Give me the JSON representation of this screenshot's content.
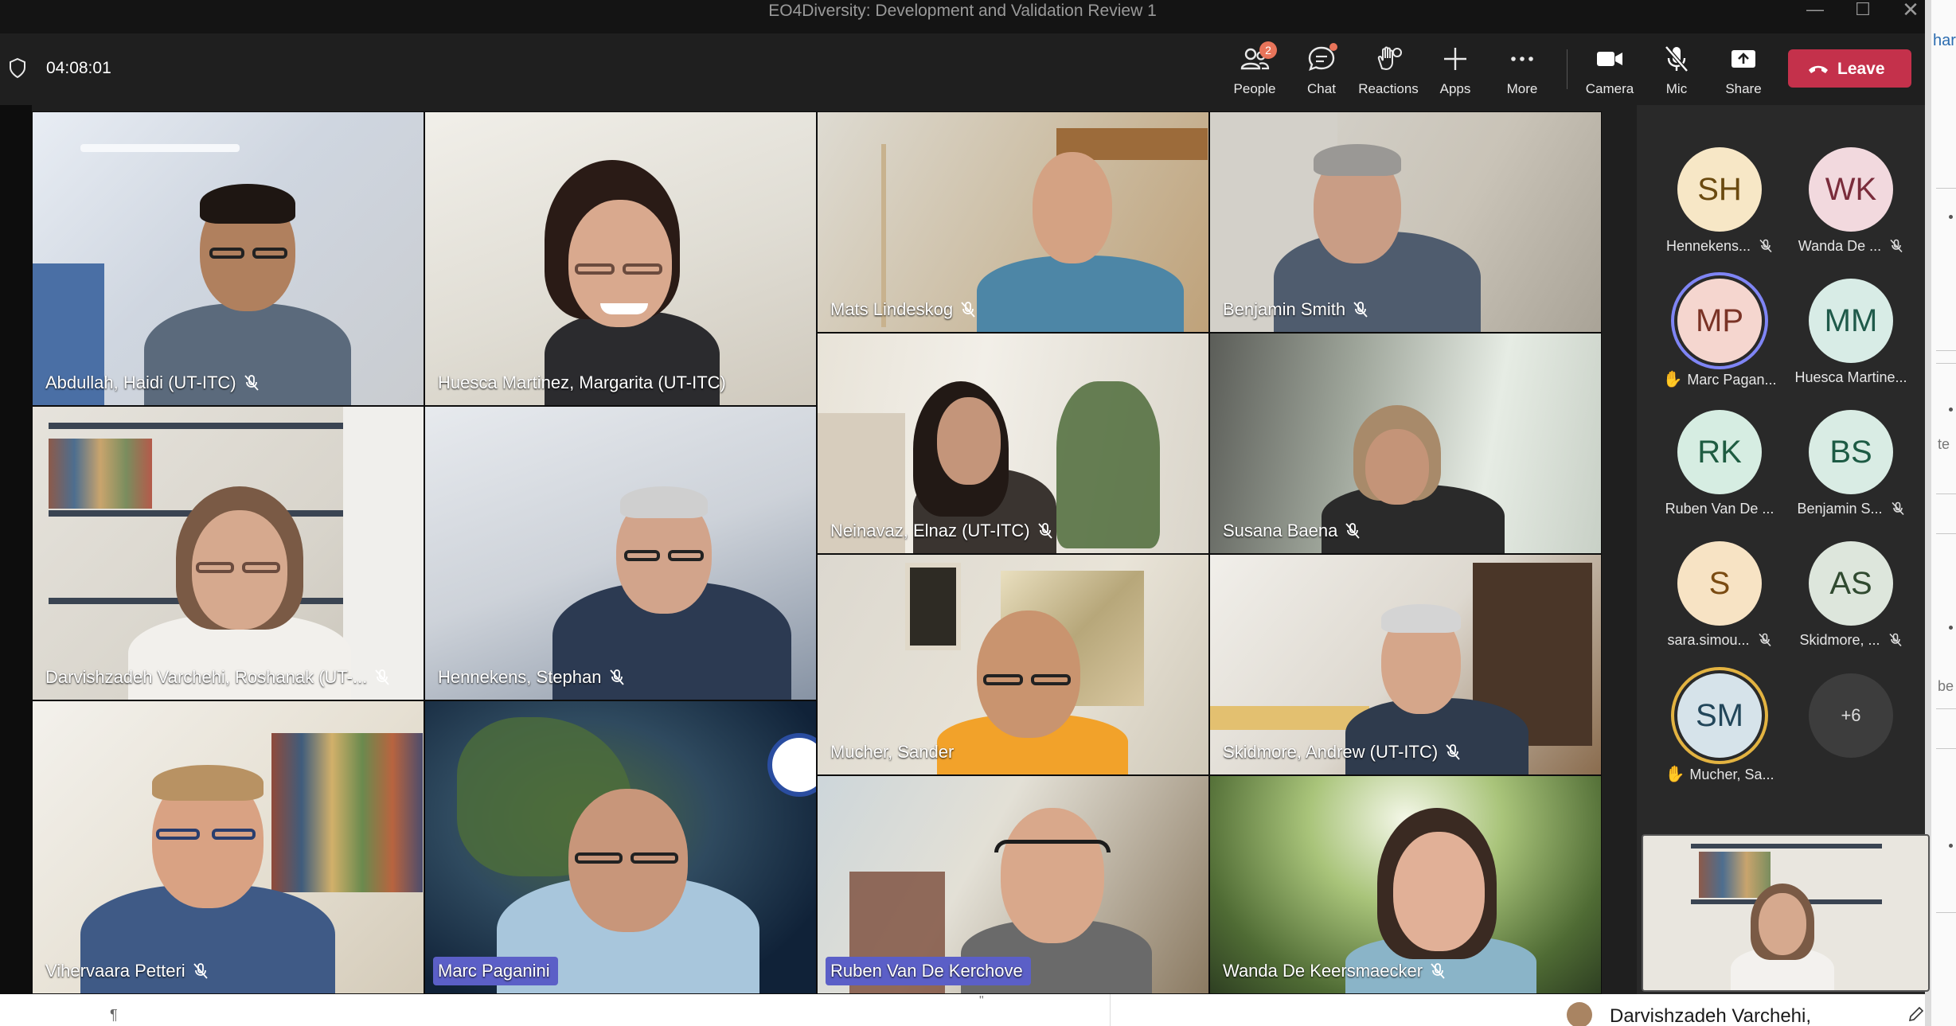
{
  "window": {
    "title": "EO4Diversity: Development and Validation Review 1",
    "side_peek_text": "har",
    "side_peek_fragments": [
      "te",
      "be"
    ]
  },
  "toolbar": {
    "timer": "04:08:01",
    "buttons": [
      {
        "label": "People",
        "icon": "people-icon",
        "badge": "2"
      },
      {
        "label": "Chat",
        "icon": "chat-icon"
      },
      {
        "label": "Reactions",
        "icon": "reactions-icon"
      },
      {
        "label": "Apps",
        "icon": "plus-icon"
      },
      {
        "label": "More",
        "icon": "ellipsis-icon"
      },
      {
        "label": "Camera",
        "icon": "camera-icon"
      },
      {
        "label": "Mic",
        "icon": "mic-off-icon"
      },
      {
        "label": "Share",
        "icon": "share-icon"
      }
    ],
    "leave_label": "Leave",
    "colors": {
      "leave": "#c4314b",
      "badge": "#e8745a",
      "accent": "#5b5fc7"
    }
  },
  "video_tiles": [
    {
      "name": "Abdullah, Haidi (UT-ITC)",
      "muted": true
    },
    {
      "name": "Huesca Martinez, Margarita (UT-ITC)",
      "muted": false
    },
    {
      "name": "Mats Lindeskog",
      "muted": true
    },
    {
      "name": "Benjamin Smith",
      "muted": true
    },
    {
      "name": "Neinavaz, Elnaz (UT-ITC)",
      "muted": true
    },
    {
      "name": "Susana Baena",
      "muted": true
    },
    {
      "name": "Darvishzadeh Varchehi, Roshanak (UT-...",
      "muted": true
    },
    {
      "name": "Hennekens, Stephan",
      "muted": true
    },
    {
      "name": "Mucher, Sander",
      "muted": false
    },
    {
      "name": "Skidmore, Andrew (UT-ITC)",
      "muted": true
    },
    {
      "name": "Vihervaara Petteri",
      "muted": true
    },
    {
      "name": "Marc Paganini",
      "muted": false,
      "speaking": true
    },
    {
      "name": "Ruben Van De Kerchove",
      "muted": false,
      "speaking": true
    },
    {
      "name": "Wanda De Keersmaecker",
      "muted": true
    }
  ],
  "participants": [
    {
      "initials": "SH",
      "name": "Hennekens...",
      "muted": true,
      "color": "#f7e7c6",
      "text": "#6b4a10"
    },
    {
      "initials": "WK",
      "name": "Wanda De ...",
      "muted": true,
      "color": "#f2d9de",
      "text": "#7a2c3b"
    },
    {
      "initials": "MP",
      "name": "Marc Pagan...",
      "muted": false,
      "hand": true,
      "color": "#f5d6cf",
      "text": "#7a3326",
      "ring": "#7f85f5"
    },
    {
      "initials": "MM",
      "name": "Huesca Martine...",
      "muted": false,
      "color": "#d8ece6",
      "text": "#1f5a4a"
    },
    {
      "initials": "RK",
      "name": "Ruben Van De ...",
      "muted": false,
      "color": "#d6ede2",
      "text": "#1e5c41"
    },
    {
      "initials": "BS",
      "name": "Benjamin S...",
      "muted": true,
      "color": "#d9ece4",
      "text": "#1d5b44"
    },
    {
      "initials": "S",
      "name": "sara.simou...",
      "muted": true,
      "color": "#f7e3c4",
      "text": "#7a4b12"
    },
    {
      "initials": "AS",
      "name": "Skidmore, ...",
      "muted": true,
      "color": "#dde6dc",
      "text": "#304a30"
    },
    {
      "initials": "SM",
      "name": "Mucher, Sa...",
      "muted": false,
      "hand": true,
      "color": "#d6e3ea",
      "text": "#22465a",
      "ring": "#e3b341"
    },
    {
      "initials": "+6",
      "name": "",
      "more": true
    }
  ],
  "bottom_bar": {
    "pilcrow": "¶",
    "mark": "\"",
    "person": "Darvishzadeh Varchehi,"
  }
}
